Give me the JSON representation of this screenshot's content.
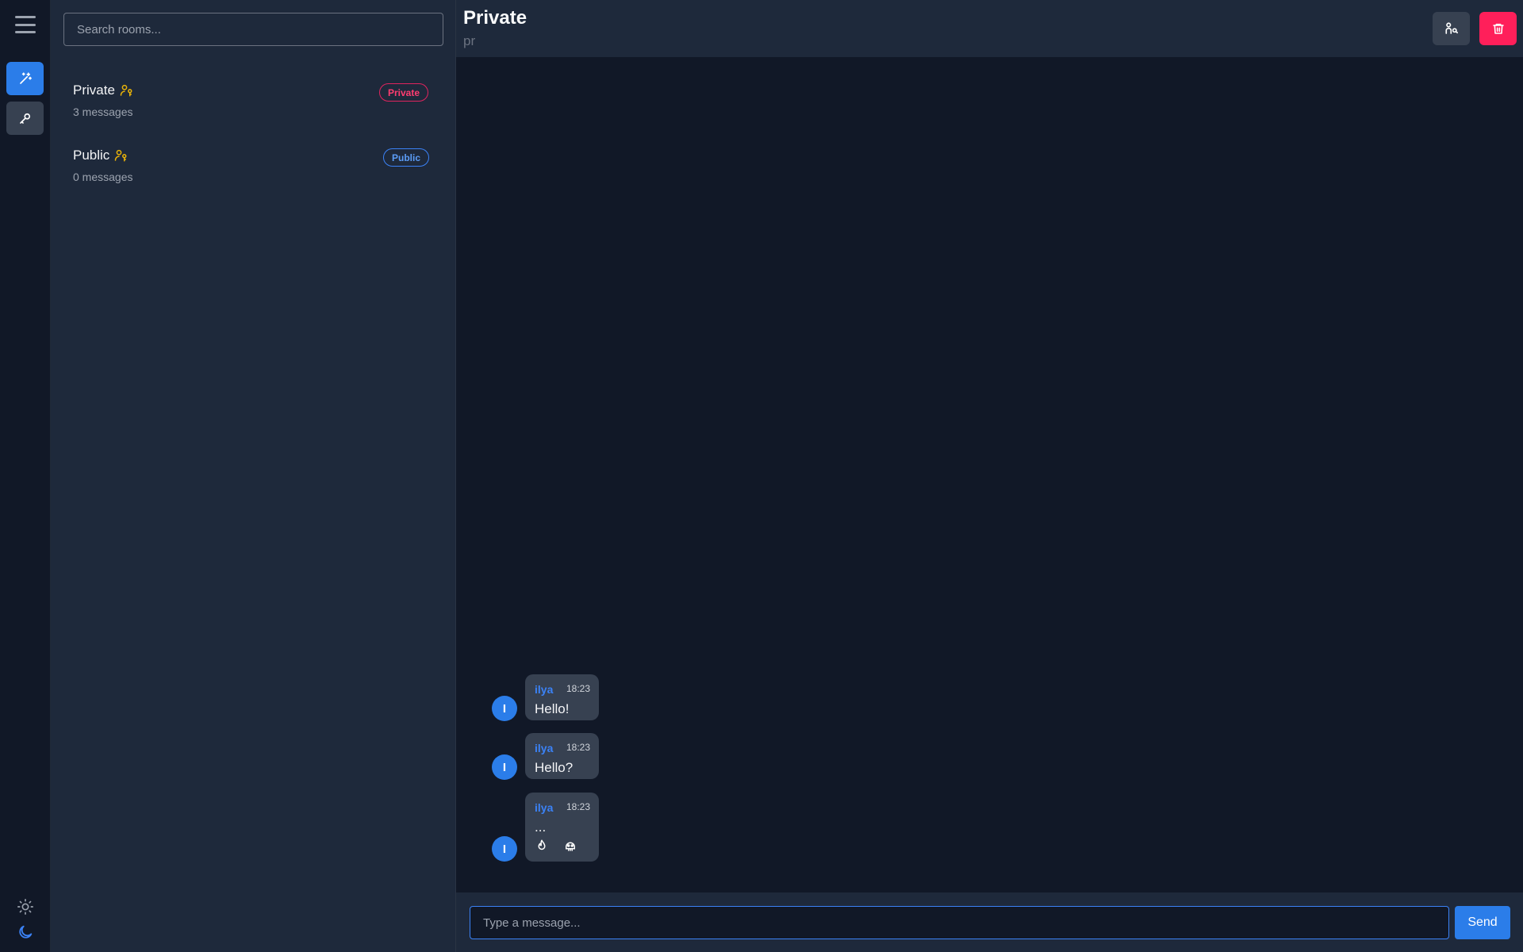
{
  "colors": {
    "accent": "#2b7de9",
    "danger": "#ff1f5a",
    "key_icon": "#eab308",
    "author": "#3b82f6"
  },
  "rail": {
    "menu_icon": "hamburger-menu-icon",
    "buttons": [
      {
        "icon": "magic-wand-icon",
        "active": true
      },
      {
        "icon": "key-icon",
        "active": false
      }
    ],
    "theme": {
      "light_icon": "sun-icon",
      "dark_icon": "moon-icon"
    }
  },
  "search": {
    "placeholder": "Search rooms..."
  },
  "rooms": [
    {
      "name": "Private",
      "count": "3 messages",
      "badge": "Private",
      "icon": "user-key-icon"
    },
    {
      "name": "Public",
      "count": "0 messages",
      "badge": "Public",
      "icon": "user-key-icon"
    }
  ],
  "header": {
    "title": "Private",
    "subtitle": "pr",
    "members_icon": "user-key-icon",
    "delete_icon": "trash-icon"
  },
  "messages": [
    {
      "avatar": "I",
      "author": "ilya",
      "time": "18:23",
      "text": "Hello!"
    },
    {
      "avatar": "I",
      "author": "ilya",
      "time": "18:23",
      "text": "Hello?"
    },
    {
      "avatar": "I",
      "author": "ilya",
      "time": "18:23",
      "text": "...",
      "reactions": [
        "fire-icon",
        "skull-icon"
      ]
    }
  ],
  "composer": {
    "placeholder": "Type a message...",
    "send_label": "Send"
  }
}
